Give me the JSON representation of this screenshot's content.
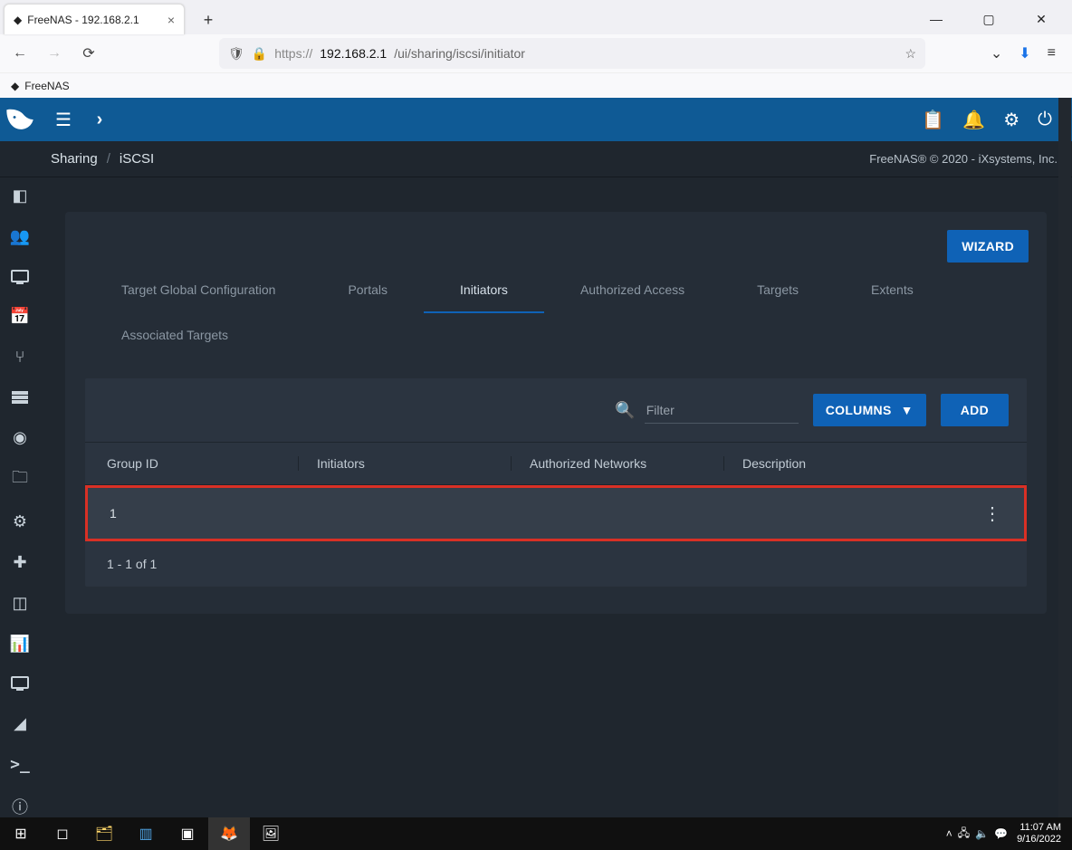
{
  "browser": {
    "tab_title": "FreeNAS - 192.168.2.1",
    "url_prefix": "https://",
    "url_bold": "192.168.2.1",
    "url_suffix": "/ui/sharing/iscsi/initiator",
    "bookmark_label": "FreeNAS"
  },
  "appbar": {
    "menu": "menu-icon",
    "chevron": "chevron-right-icon"
  },
  "breadcrumb": {
    "a": "Sharing",
    "b": "iSCSI"
  },
  "copyright": "FreeNAS® © 2020 - iXsystems, Inc.",
  "buttons": {
    "wizard": "WIZARD",
    "columns": "COLUMNS",
    "add": "ADD"
  },
  "tabs": {
    "tgc": "Target Global Configuration",
    "portals": "Portals",
    "initiators": "Initiators",
    "auth": "Authorized Access",
    "targets": "Targets",
    "extents": "Extents",
    "assoc": "Associated Targets"
  },
  "filter_placeholder": "Filter",
  "columns_header": {
    "group": "Group ID",
    "initiators": "Initiators",
    "networks": "Authorized Networks",
    "description": "Description"
  },
  "rows": [
    {
      "group": "1",
      "initiators": "",
      "networks": "",
      "description": ""
    }
  ],
  "pager": "1 - 1 of 1",
  "taskbar": {
    "time": "11:07 AM",
    "date": "9/16/2022"
  }
}
